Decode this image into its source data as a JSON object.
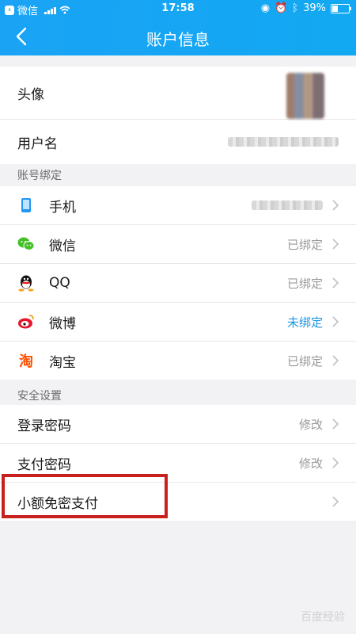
{
  "status_bar": {
    "back_app": "微信",
    "time": "17:58",
    "battery": "39%",
    "battery_level": 0.39
  },
  "nav": {
    "title": "账户信息"
  },
  "profile": {
    "avatar_label": "头像",
    "username_label": "用户名"
  },
  "binding": {
    "section_title": "账号绑定",
    "items": [
      {
        "label": "手机",
        "status": "",
        "icon": "phone-icon"
      },
      {
        "label": "微信",
        "status": "已绑定",
        "icon": "wechat-icon"
      },
      {
        "label": "QQ",
        "status": "已绑定",
        "icon": "qq-icon"
      },
      {
        "label": "微博",
        "status": "未绑定",
        "icon": "weibo-icon"
      },
      {
        "label": "淘宝",
        "status": "已绑定",
        "icon": "taobao-icon"
      }
    ]
  },
  "security": {
    "section_title": "安全设置",
    "items": [
      {
        "label": "登录密码",
        "action": "修改"
      },
      {
        "label": "支付密码",
        "action": "修改"
      },
      {
        "label": "小额免密支付",
        "action": ""
      }
    ]
  },
  "watermark": "百度经验",
  "colors": {
    "header": "#1aa3f5",
    "highlight": "#c7201d",
    "unbound": "#1e96e3"
  }
}
